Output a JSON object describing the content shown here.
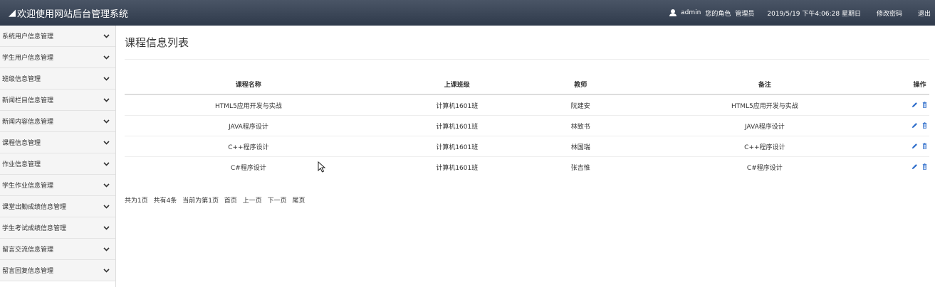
{
  "app": {
    "title": "欢迎使用网站后台管理系统"
  },
  "header": {
    "username": "admin",
    "role_label": "您的角色",
    "role": "管理员",
    "datetime": "2019/5/19 下午4:06:28 星期日",
    "change_password": "修改密码",
    "logout": "退出"
  },
  "sidebar": {
    "items": [
      {
        "label": "系统用户信息管理"
      },
      {
        "label": "学生用户信息管理"
      },
      {
        "label": "班级信息管理"
      },
      {
        "label": "新闻栏目信息管理"
      },
      {
        "label": "新闻内容信息管理"
      },
      {
        "label": "课程信息管理"
      },
      {
        "label": "作业信息管理"
      },
      {
        "label": "学生作业信息管理"
      },
      {
        "label": "课堂出勤成绩信息管理"
      },
      {
        "label": "学生考试成绩信息管理"
      },
      {
        "label": "留言交流信息管理"
      },
      {
        "label": "留言回复信息管理"
      }
    ]
  },
  "main": {
    "title": "课程信息列表",
    "table": {
      "headers": [
        "课程名称",
        "上课班级",
        "教师",
        "备注",
        "操作"
      ],
      "rows": [
        [
          "HTML5应用开发与实战",
          "计算机1601班",
          "阮建安",
          "HTML5应用开发与实战"
        ],
        [
          "JAVA程序设计",
          "计算机1601班",
          "林致书",
          "JAVA程序设计"
        ],
        [
          "C++程序设计",
          "计算机1601班",
          "林国瑞",
          "C++程序设计"
        ],
        [
          "C#程序设计",
          "计算机1601班",
          "张吉惟",
          "C#程序设计"
        ]
      ]
    },
    "pager": {
      "total_pages": "共为1页",
      "total_items": "共有4条",
      "current": "当前为第1页",
      "first": "首页",
      "prev": "上一页",
      "next": "下一页",
      "last": "尾页"
    }
  },
  "colors": {
    "header_bg": "#3b4555",
    "accent": "#2f6ecb",
    "sidebar_bg": "#f5f5f5"
  },
  "icons": {
    "brand": "paper-plane-icon",
    "user": "user-icon",
    "edit": "pencil-icon",
    "delete": "trash-icon"
  }
}
